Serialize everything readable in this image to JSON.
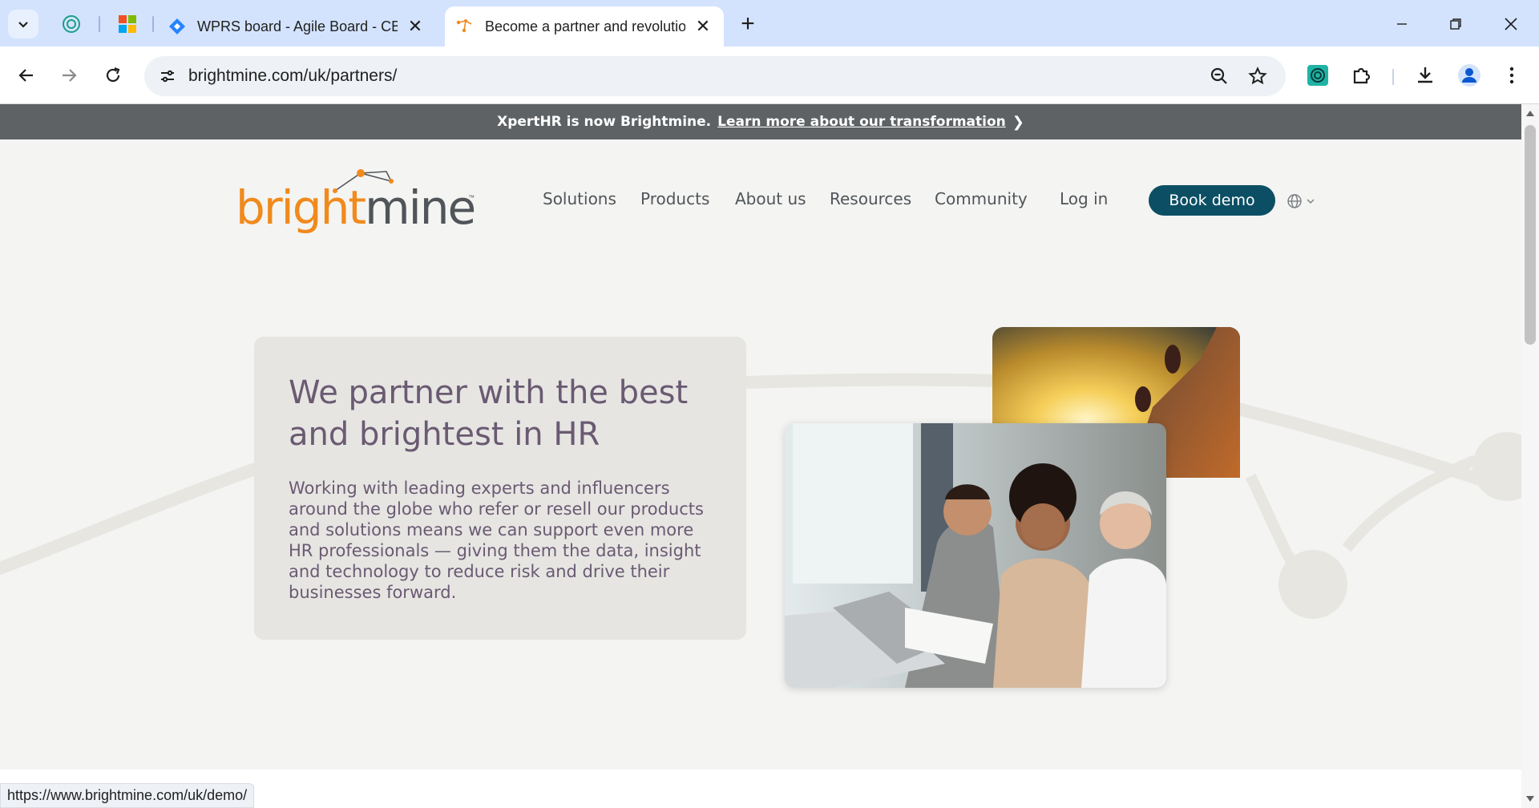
{
  "browser": {
    "tabs": [
      {
        "title": "WPRS board - Agile Board - CB",
        "close": "✕"
      },
      {
        "title": "Become a partner and revolutionise",
        "close": "✕"
      }
    ],
    "new_tab": "+",
    "url": "brightmine.com/uk/partners/",
    "status_url": "https://www.brightmine.com/uk/demo/"
  },
  "banner": {
    "text": "XpertHR is now Brightmine.",
    "link": "Learn more about our transformation",
    "chevron": "❯"
  },
  "header": {
    "logo": {
      "part1": "bright",
      "part2": "mine",
      "tm": "™"
    },
    "nav": [
      "Solutions",
      "Products",
      "About us",
      "Resources",
      "Community"
    ],
    "login": "Log in",
    "cta": "Book demo",
    "language_icon": "globe-icon"
  },
  "hero": {
    "title": "We partner with the best and brightest in HR",
    "body": "Working with leading experts and influencers around the globe who refer or resell our products and solutions means we can support even more HR professionals — giving them the data, insight and technology to reduce risk and drive their businesses forward."
  },
  "colors": {
    "brand_orange": "#f08a1c",
    "brand_grey": "#505559",
    "cta_teal": "#0c4f64",
    "hero_text": "#6a5a72",
    "banner_bg": "#5e6265"
  }
}
